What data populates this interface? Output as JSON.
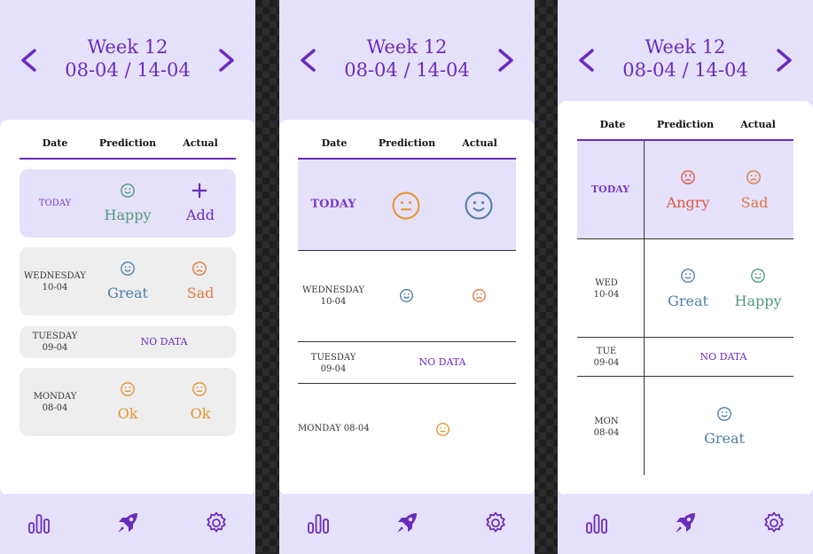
{
  "header": {
    "week": "Week 12",
    "dates": "08-04 / 14-04"
  },
  "columns": {
    "date": "Date",
    "prediction": "Prediction",
    "actual": "Actual"
  },
  "rows": {
    "today": "TODAY",
    "wed1": "WEDNESDAY",
    "wed1_date": "10-04",
    "tue1": "TUESDAY",
    "tue1_date": "09-04",
    "mon1": "MONDAY",
    "mon1_date": "08-04",
    "wed2": "WEDNESDAY",
    "wed2_date": "10-04",
    "tue2": "TUESDAY",
    "tue2_date": "09-04",
    "mon2": "MONDAY 08-04",
    "wed3": "WED",
    "wed3_date": "10-04",
    "tue3": "TUE",
    "tue3_date": "09-04",
    "mon3": "MON",
    "mon3_date": "08-04"
  },
  "no_data": "NO DATA",
  "moods": {
    "happy": "Happy",
    "add": "Add",
    "great": "Great",
    "sad": "Sad",
    "ok": "Ok",
    "angry": "Angry"
  },
  "colors": {
    "accent": "#6a2bbd",
    "background": "#e6e1fb",
    "happy": "#4f9a7c",
    "great": "#4f7fa8",
    "sad": "#e07a3e",
    "ok": "#e6952e",
    "angry": "#e0563e"
  },
  "icons": [
    "chevron-left-icon",
    "chevron-right-icon",
    "bar-chart-icon",
    "rocket-icon",
    "gear-icon",
    "plus-icon",
    "smiley-icon",
    "sad-face-icon",
    "neutral-face-icon",
    "angry-face-icon"
  ]
}
